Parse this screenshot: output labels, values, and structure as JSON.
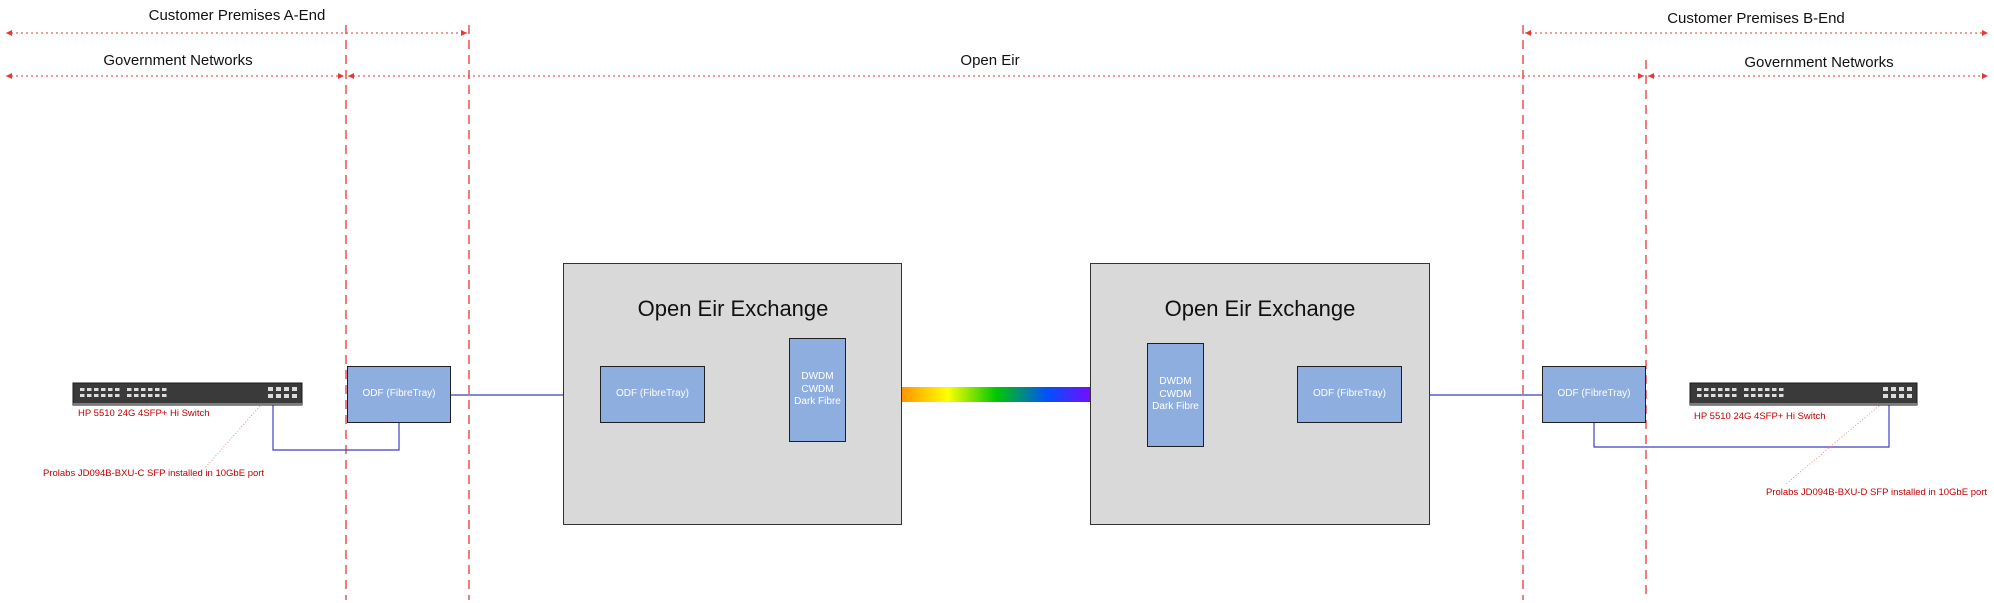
{
  "zones": {
    "a_end": "Customer Premises A-End",
    "b_end": "Customer Premises B-End",
    "gov_left": "Government Networks",
    "open_eir": "Open Eir",
    "gov_right": "Government Networks"
  },
  "exchanges": [
    {
      "title": "Open Eir Exchange",
      "odf": "ODF (FibreTray)",
      "dwdm": [
        "DWDM",
        "CWDM",
        "Dark Fibre"
      ]
    },
    {
      "title": "Open Eir Exchange",
      "odf": "ODF (FibreTray)",
      "dwdm": [
        "DWDM",
        "CWDM",
        "Dark Fibre"
      ]
    }
  ],
  "customer_odf": {
    "left": "ODF (FibreTray)",
    "right": "ODF (FibreTray)"
  },
  "switches": {
    "left": "HP 5510 24G 4SFP+ Hi Switch",
    "right": "HP 5510 24G 4SFP+ Hi Switch"
  },
  "sfp_notes": {
    "left": "Prolabs JD094B-BXU-C SFP installed in 10GbE port",
    "right": "Prolabs JD094B-BXU-D SFP installed in 10GbE port"
  },
  "colors": {
    "boundary": "#e53935",
    "fibre_link": "#3f3fbf",
    "box_fill": "#8eaee0",
    "exchange_fill": "#d9d9d9",
    "note_text": "#c00000"
  }
}
